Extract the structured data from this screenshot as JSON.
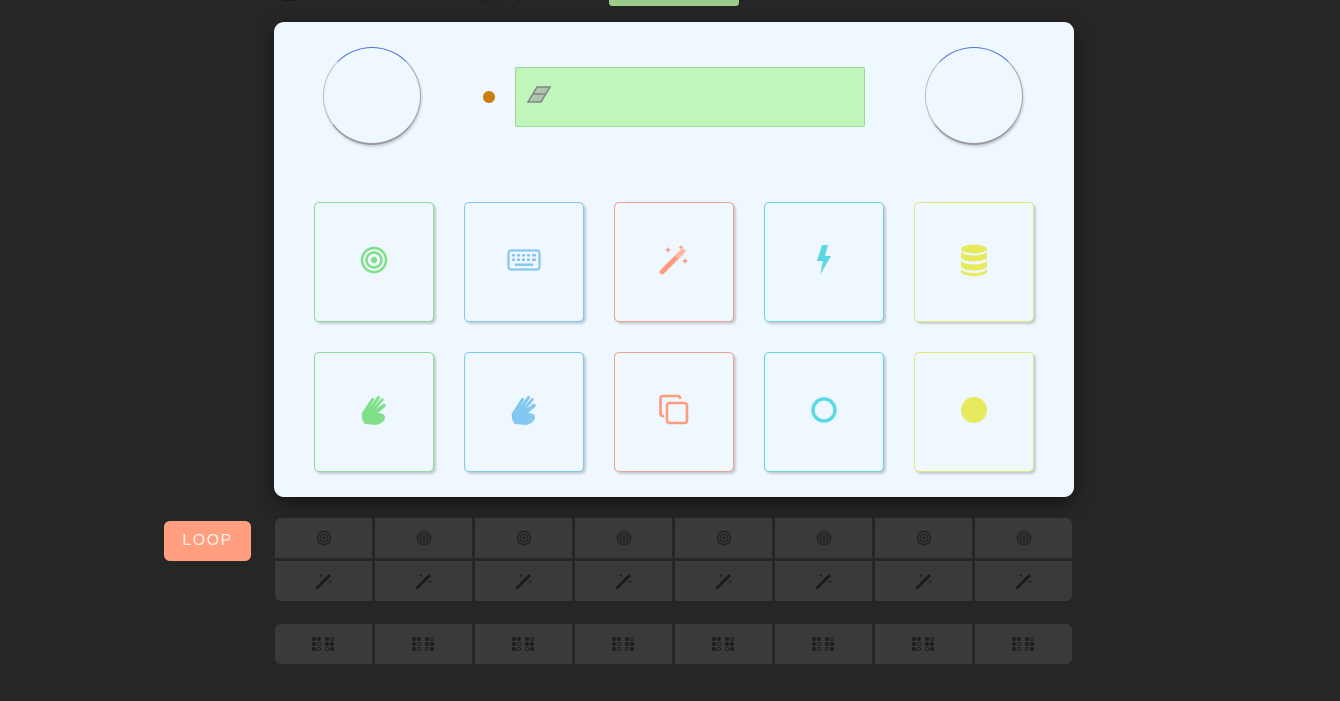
{
  "colors": {
    "background": "#262626",
    "panel": "#eff7ff",
    "lcd": "#c0f5bc",
    "indicator": "#c87f10",
    "loop_button": "#ff9f7f",
    "pad_green": "#8fdc95",
    "pad_blue": "#7ec8ee",
    "pad_salmon": "#f0a08c",
    "pad_cyan": "#6ad4de",
    "pad_yellow": "#e4e678"
  },
  "display": {
    "icon": "eraser-icon",
    "text": ""
  },
  "pads": [
    {
      "icon": "target-icon",
      "color": "green"
    },
    {
      "icon": "keyboard-icon",
      "color": "blue"
    },
    {
      "icon": "magic-wand-icon",
      "color": "salmon"
    },
    {
      "icon": "lightning-bolt-icon",
      "color": "cyan"
    },
    {
      "icon": "database-icon",
      "color": "yellow"
    },
    {
      "icon": "sign-language-icon",
      "color": "green"
    },
    {
      "icon": "sign-language-icon",
      "color": "blue"
    },
    {
      "icon": "copy-icon",
      "color": "salmon"
    },
    {
      "icon": "circle-outline-icon",
      "color": "cyan"
    },
    {
      "icon": "circle-filled-icon",
      "color": "yellow"
    }
  ],
  "loop_button": {
    "label": "LOOP"
  },
  "sequencer": {
    "row1_icon": "target-icon",
    "row2_icon": "magic-wand-icon",
    "row3_icon": "braille-icon",
    "steps": 8
  }
}
